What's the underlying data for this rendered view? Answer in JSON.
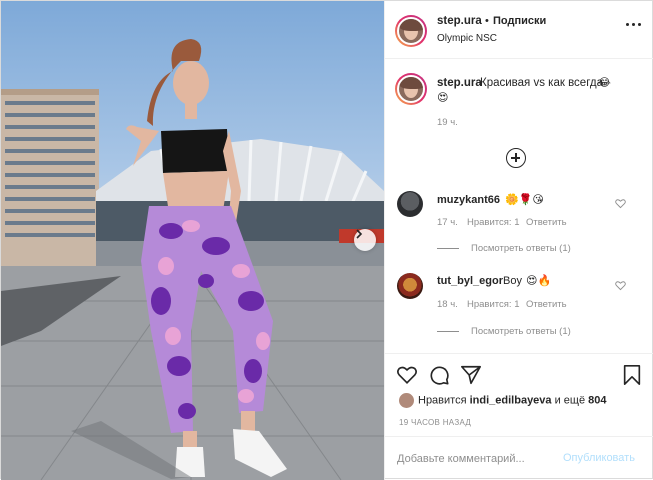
{
  "header": {
    "username": "step.ura",
    "separator": "•",
    "follow_label": "Подписки",
    "location": "Olympic NSC"
  },
  "caption": {
    "username": "step.ura",
    "text": "Красивая vs как всегда",
    "emoji_1": "😂",
    "emoji_2": "😍",
    "time": "19 ч."
  },
  "comments": [
    {
      "username": "muzykant66",
      "emojis": "🌼🌹😘",
      "time": "17 ч.",
      "likes": "Нравится: 1",
      "reply": "Ответить",
      "view_replies": "Посмотреть ответы (1)"
    },
    {
      "username": "tut_byl_egor",
      "text": "Boy",
      "emojis": "😍🔥",
      "time": "18 ч.",
      "likes": "Нравится: 1",
      "reply": "Ответить",
      "view_replies": "Посмотреть ответы (1)"
    }
  ],
  "likes": {
    "prefix": "Нравится",
    "user": "indi_edilbayeva",
    "middle": "и ещё",
    "count": "804"
  },
  "time_ago": "19 ЧАСОВ НАЗАД",
  "comment_box": {
    "placeholder": "Добавьте комментарий...",
    "publish_label": "Опубликовать"
  },
  "icons": {
    "heart": "heart-icon",
    "comment": "comment-icon",
    "share": "paper-plane-icon",
    "save": "bookmark-icon",
    "more": "more-icon",
    "load_more": "plus-circle-icon",
    "next": "chevron-right-icon"
  },
  "colors": {
    "publish_disabled": "#b2dffc",
    "meta": "#8e8e8e",
    "text": "#262626"
  }
}
